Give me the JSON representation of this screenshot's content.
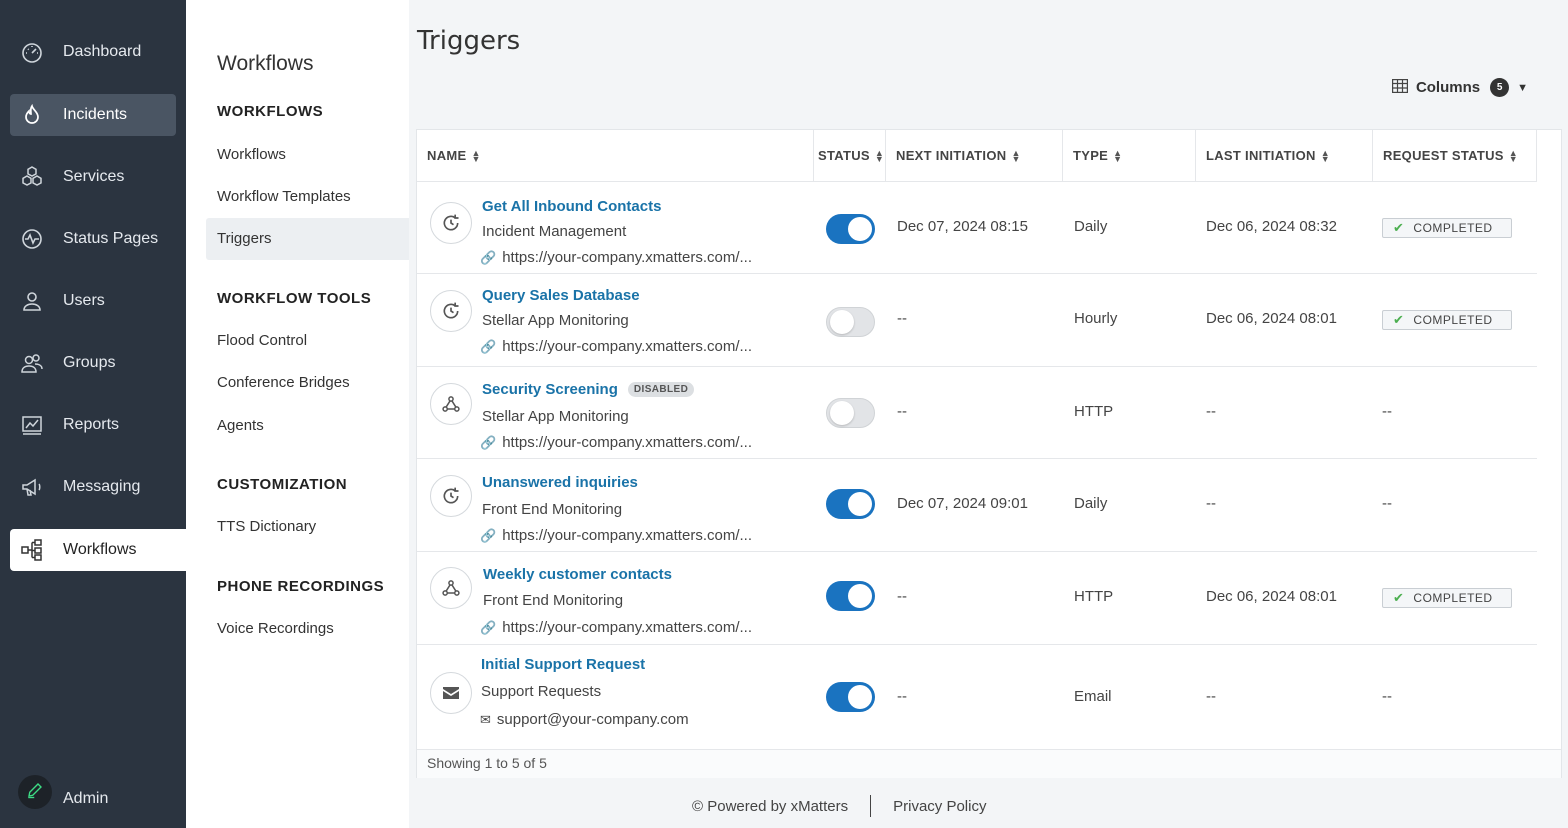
{
  "nav": {
    "items": [
      {
        "label": "Dashboard",
        "icon": "speedometer-icon"
      },
      {
        "label": "Incidents",
        "icon": "flame-icon"
      },
      {
        "label": "Services",
        "icon": "hexagons-icon"
      },
      {
        "label": "Status Pages",
        "icon": "pulse-icon"
      },
      {
        "label": "Users",
        "icon": "user-icon"
      },
      {
        "label": "Groups",
        "icon": "group-icon"
      },
      {
        "label": "Reports",
        "icon": "chart-icon"
      },
      {
        "label": "Messaging",
        "icon": "megaphone-icon"
      },
      {
        "label": "Workflows",
        "icon": "flow-icon"
      }
    ],
    "admin_label": "Admin"
  },
  "subnav": {
    "title": "Workflows",
    "sections": [
      {
        "heading": "WORKFLOWS",
        "links": [
          "Workflows",
          "Workflow Templates",
          "Triggers"
        ]
      },
      {
        "heading": "WORKFLOW TOOLS",
        "links": [
          "Flood Control",
          "Conference Bridges",
          "Agents"
        ]
      },
      {
        "heading": "CUSTOMIZATION",
        "links": [
          "TTS Dictionary"
        ]
      },
      {
        "heading": "PHONE RECORDINGS",
        "links": [
          "Voice Recordings"
        ]
      }
    ]
  },
  "main": {
    "title": "Triggers",
    "columns_label": "Columns",
    "columns_count": "5",
    "headers": [
      "NAME",
      "STATUS",
      "NEXT INITIATION",
      "TYPE",
      "LAST INITIATION",
      "REQUEST STATUS"
    ],
    "rows": [
      {
        "name": "Get All Inbound Contacts",
        "sub": "Incident Management",
        "url": "https://your-company.xmatters.com/...",
        "icon": "schedule-icon",
        "enabled": true,
        "disabled_tag": "",
        "next": "Dec 07, 2024 08:15",
        "type": "Daily",
        "last": "Dec 06, 2024 08:32",
        "request_status": "COMPLETED"
      },
      {
        "name": "Query Sales Database",
        "sub": "Stellar App Monitoring",
        "url": "https://your-company.xmatters.com/...",
        "icon": "schedule-icon",
        "enabled": false,
        "disabled_tag": "",
        "next": "--",
        "type": "Hourly",
        "last": "Dec 06, 2024 08:01",
        "request_status": "COMPLETED"
      },
      {
        "name": "Security Screening",
        "sub": "Stellar App Monitoring",
        "url": "https://your-company.xmatters.com/...",
        "icon": "webhook-icon",
        "enabled": false,
        "disabled_tag": "DISABLED",
        "next": "--",
        "type": "HTTP",
        "last": "--",
        "request_status": "--"
      },
      {
        "name": "Unanswered inquiries",
        "sub": "Front End Monitoring",
        "url": "https://your-company.xmatters.com/...",
        "icon": "schedule-icon",
        "enabled": true,
        "disabled_tag": "",
        "next": "Dec 07, 2024 09:01",
        "type": "Daily",
        "last": "--",
        "request_status": "--"
      },
      {
        "name": "Weekly customer contacts",
        "sub": "Front End Monitoring",
        "url": "https://your-company.xmatters.com/...",
        "icon": "webhook-icon",
        "enabled": true,
        "disabled_tag": "",
        "next": "--",
        "type": "HTTP",
        "last": "Dec 06, 2024 08:01",
        "request_status": "COMPLETED"
      },
      {
        "name": "Initial Support Request",
        "sub": "Support Requests",
        "url": "support@your-company.com",
        "icon": "envelope-icon",
        "enabled": true,
        "disabled_tag": "",
        "next": "--",
        "type": "Email",
        "last": "--",
        "request_status": "--"
      }
    ],
    "showing": "Showing 1 to 5 of 5"
  },
  "footer": {
    "powered": "© Powered by xMatters",
    "privacy": "Privacy Policy"
  },
  "colors": {
    "nav_bg": "#2b3440",
    "link_blue": "#1a73a8",
    "toggle_on": "#1a73c0",
    "check_green": "#4caf50"
  }
}
